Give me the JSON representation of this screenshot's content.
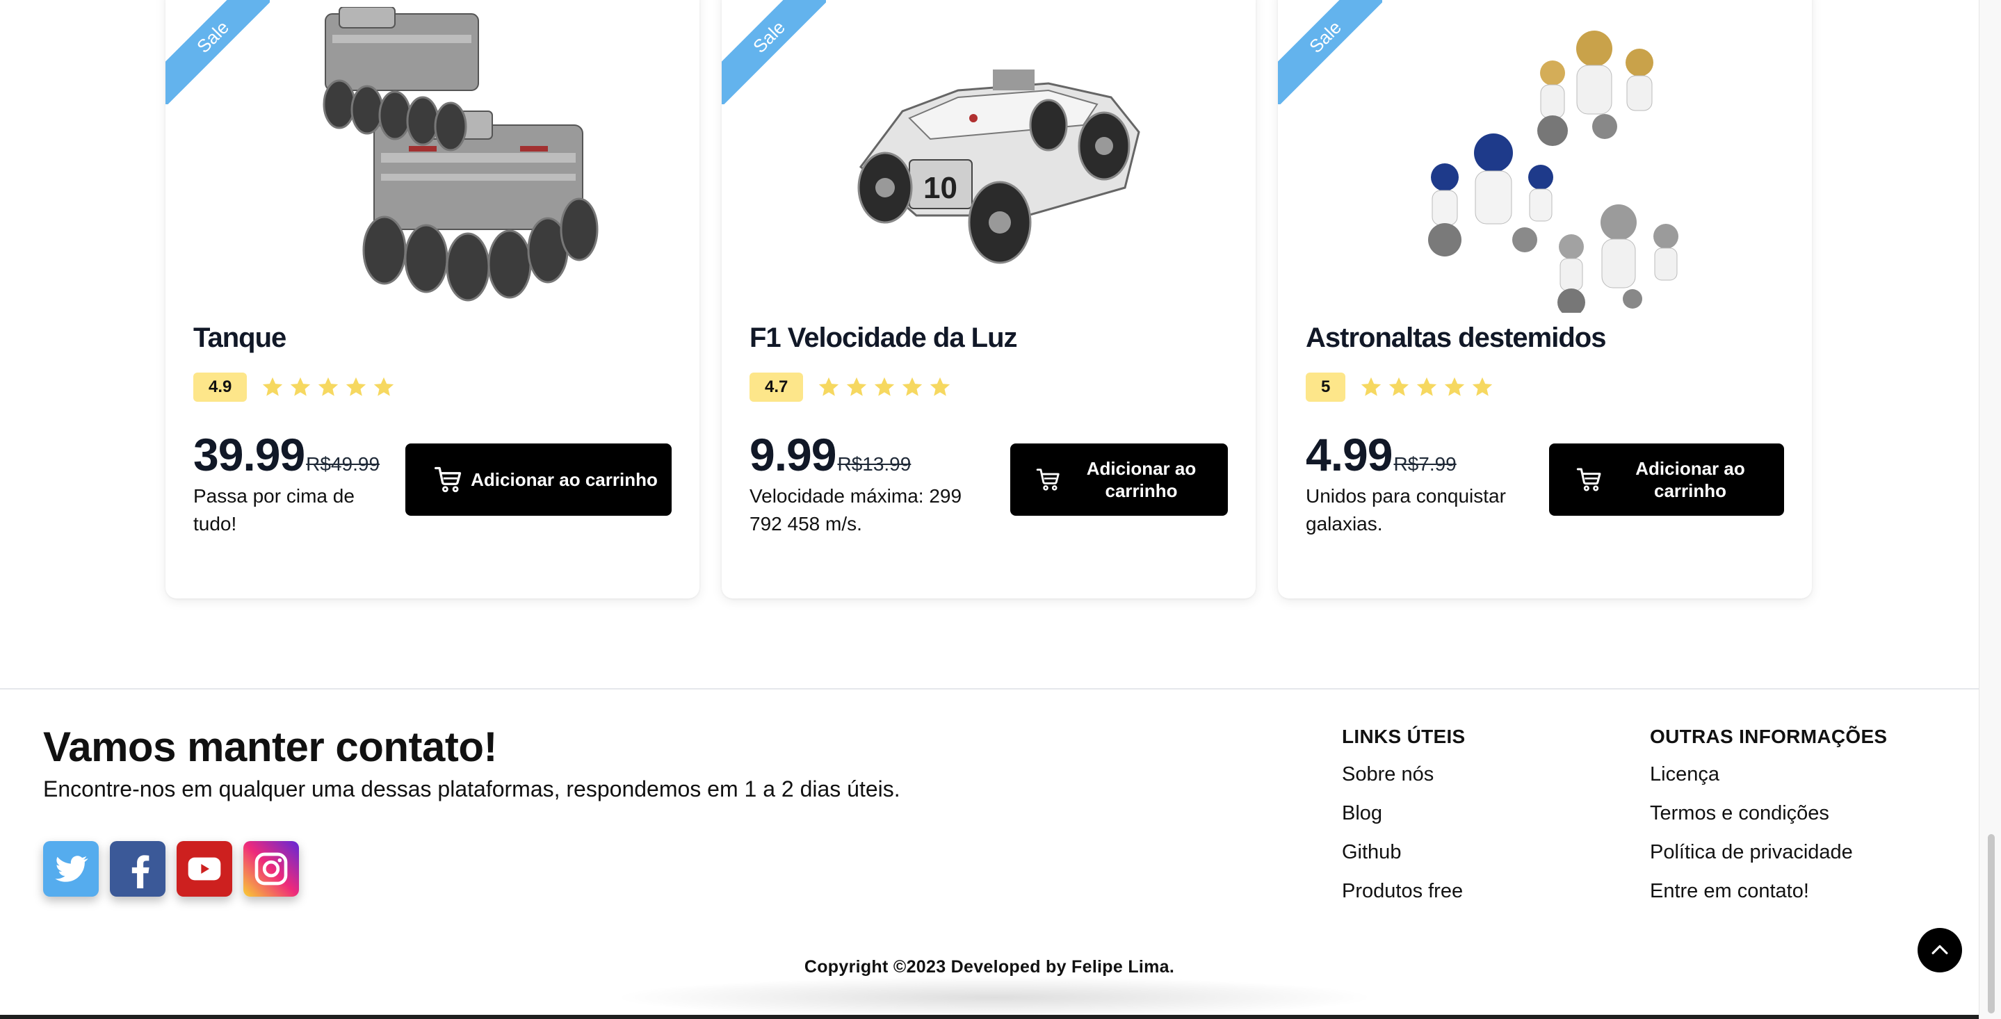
{
  "products": [
    {
      "badge": "Sale",
      "title": "Tanque",
      "rating": "4.9",
      "stars": 5,
      "price": "39.99",
      "old_price": "R$49.99",
      "description": "Passa por cima de tudo!",
      "button_label": "Adicionar ao carrinho"
    },
    {
      "badge": "Sale",
      "title": "F1 Velocidade da Luz",
      "rating": "4.7",
      "stars": 5,
      "price": "9.99",
      "old_price": "R$13.99",
      "description": "Velocidade máxima: 299 792 458 m/s.",
      "button_label": "Adicionar ao carrinho"
    },
    {
      "badge": "Sale",
      "title": "Astronaltas destemidos",
      "rating": "5",
      "stars": 5,
      "price": "4.99",
      "old_price": "R$7.99",
      "description": "Unidos para conquistar galaxias.",
      "button_label": "Adicionar ao carrinho"
    }
  ],
  "footer": {
    "title": "Vamos manter contato!",
    "subtitle": "Encontre-nos em qualquer uma dessas plataformas, respondemos em 1 a 2 dias úteis.",
    "social": [
      "twitter-icon",
      "facebook-icon",
      "youtube-icon",
      "instagram-icon"
    ],
    "useful_links": {
      "heading": "LINKS ÚTEIS",
      "items": [
        "Sobre nós",
        "Blog",
        "Github",
        "Produtos free"
      ]
    },
    "other_info": {
      "heading": "OUTRAS INFORMAÇÕES",
      "items": [
        "Licença",
        "Termos e condições",
        "Política de privacidade",
        "Entre em contato!"
      ]
    },
    "copyright": "Copyright ©2023 Developed by Felipe Lima."
  },
  "colors": {
    "ribbon": "#63b3ed",
    "rating_badge": "#fde68a",
    "star": "#f6d860",
    "button": "#000000"
  }
}
